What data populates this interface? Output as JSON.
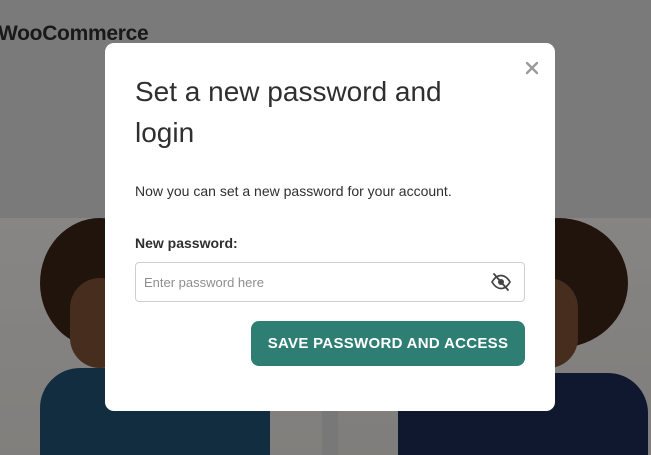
{
  "background": {
    "logo_text": "WooCommerce"
  },
  "modal": {
    "title": "Set a new password and login",
    "description": "Now you can set a new password for your account.",
    "password_label": "New password:",
    "password_placeholder": "Enter password here",
    "password_value": "",
    "submit_label": "SAVE PASSWORD AND ACCESS",
    "close_icon": "close-icon",
    "visibility_icon": "eye-slash-icon"
  },
  "colors": {
    "accent": "#2f7e74",
    "overlay": "rgba(0,0,0,0.42)",
    "modal_bg": "#ffffff"
  }
}
